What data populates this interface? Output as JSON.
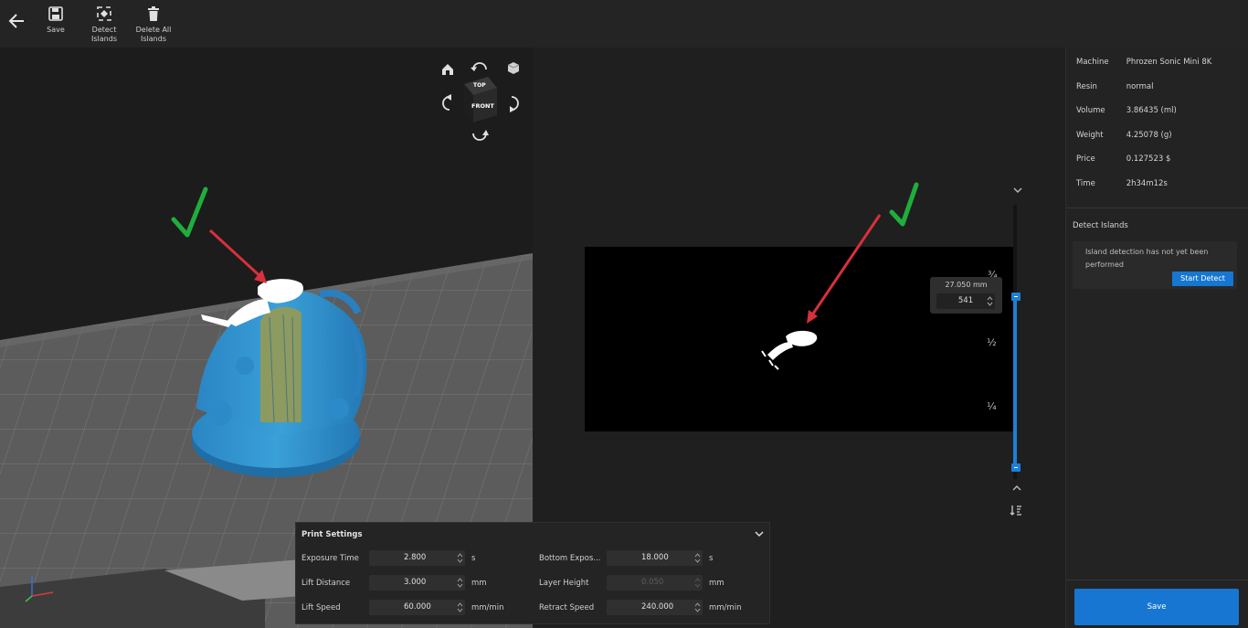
{
  "toolbar": {
    "save_label": "Save",
    "detect_islands_label": "Detect Islands",
    "delete_all_islands_label": "Delete All Islands"
  },
  "navcube": {
    "top_label": "TOP",
    "front_label": "FRONT"
  },
  "slice": {
    "layer_height_mm": "27.050 mm",
    "layer_number": "541",
    "fraction_three_quarter": "¾",
    "fraction_half": "½",
    "fraction_quarter": "¼",
    "slider_accent": "#1e7fd6"
  },
  "info": {
    "machine_label": "Machine",
    "machine_value": "Phrozen Sonic Mini 8K",
    "resin_label": "Resin",
    "resin_value": "normal",
    "volume_label": "Volume",
    "volume_value": "3.86435 (ml)",
    "weight_label": "Weight",
    "weight_value": "4.25078 (g)",
    "price_label": "Price",
    "price_value": "0.127523 $",
    "time_label": "Time",
    "time_value": "2h34m12s"
  },
  "detect_islands": {
    "title": "Detect Islands",
    "message": "Island detection has not yet been performed",
    "start_button": "Start Detect"
  },
  "save_button": "Save",
  "print_settings": {
    "title": "Print Settings",
    "exposure_time_label": "Exposure Time",
    "exposure_time_value": "2.800",
    "exposure_time_unit": "s",
    "lift_distance_label": "Lift Distance",
    "lift_distance_value": "3.000",
    "lift_distance_unit": "mm",
    "lift_speed_label": "Lift Speed",
    "lift_speed_value": "60.000",
    "lift_speed_unit": "mm/min",
    "bottom_exposure_label": "Bottom Expos...",
    "bottom_exposure_value": "18.000",
    "bottom_exposure_unit": "s",
    "layer_height_label": "Layer Height",
    "layer_height_value": "0.050",
    "layer_height_unit": "mm",
    "retract_speed_label": "Retract Speed",
    "retract_speed_value": "240.000",
    "retract_speed_unit": "mm/min"
  },
  "colors": {
    "accent": "#1677d2",
    "annotation_arrow": "#d8303c",
    "annotation_check": "#1fae3c",
    "model": "#2f8fc8"
  }
}
